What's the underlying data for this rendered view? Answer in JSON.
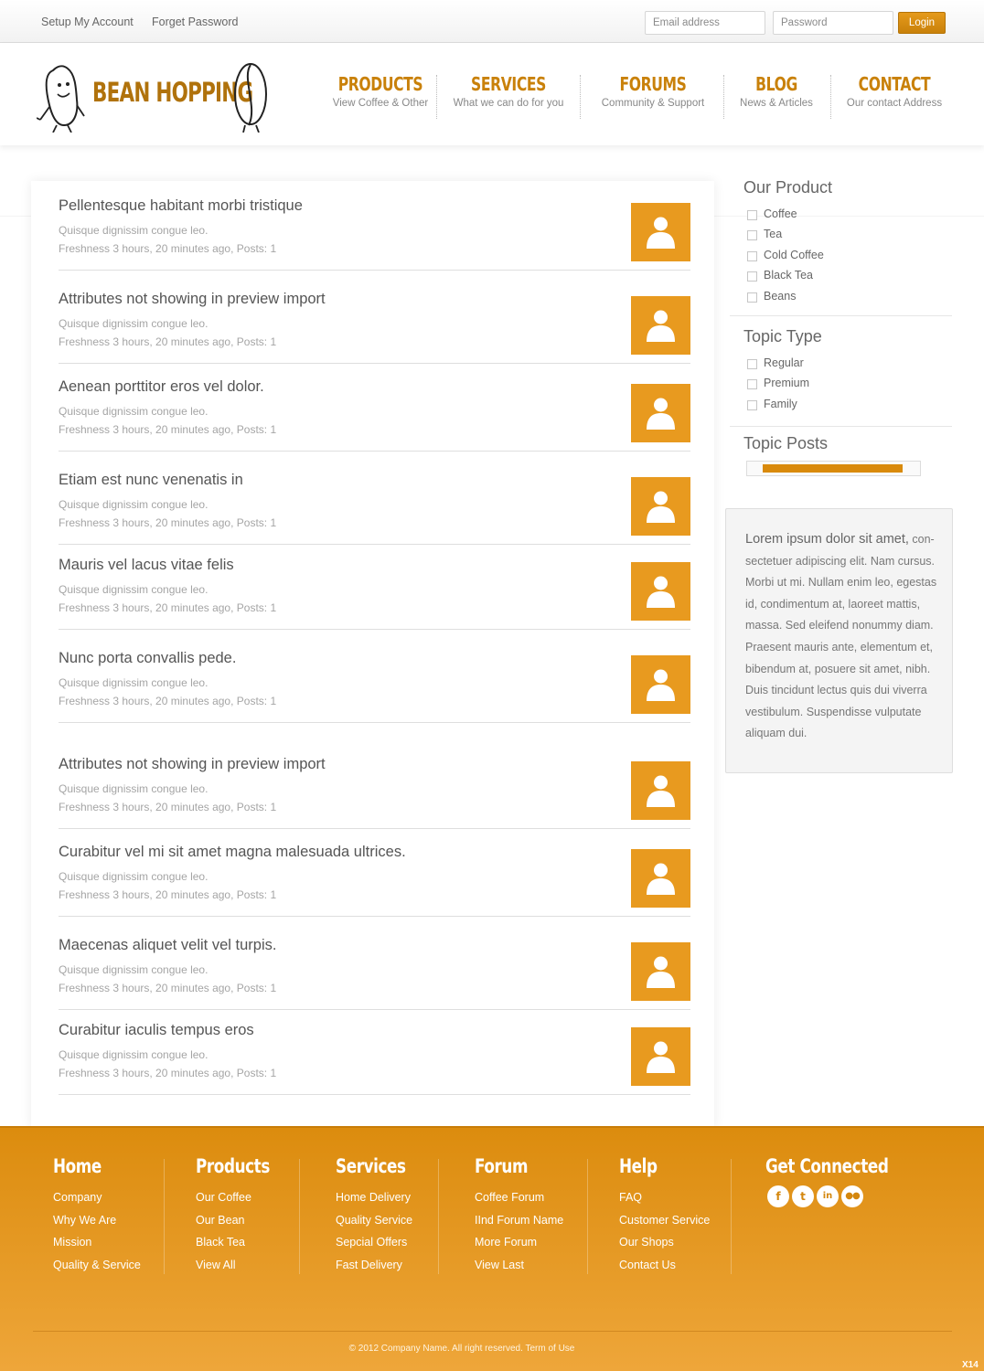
{
  "topbar": {
    "links": [
      "Setup My Account",
      "Forget Password"
    ],
    "email_placeholder": "Email address",
    "password_placeholder": "Password",
    "login_label": "Login"
  },
  "logo": {
    "text": "BEAN HOPPING"
  },
  "nav": [
    {
      "title": "PRODUCTS",
      "sub": "View Coffee & Other"
    },
    {
      "title": "SERVICES",
      "sub": "What we can do for you"
    },
    {
      "title": "FORUMS",
      "sub": "Community & Support"
    },
    {
      "title": "BLOG",
      "sub": "News & Articles"
    },
    {
      "title": "CONTACT",
      "sub": "Our contact Address"
    }
  ],
  "topics": [
    {
      "title": "Pellentesque habitant morbi tristique",
      "sub": "Quisque dignissim congue leo.",
      "meta": "Freshness 3 hours, 20 minutes ago, Posts: 1"
    },
    {
      "title": "Attributes not showing in preview import",
      "sub": "Quisque dignissim congue leo.",
      "meta": "Freshness 3 hours, 20 minutes ago, Posts: 1"
    },
    {
      "title": "Aenean porttitor eros vel dolor.",
      "sub": "Quisque dignissim congue leo.",
      "meta": "Freshness 3 hours, 20 minutes ago, Posts: 1"
    },
    {
      "title": "Etiam est nunc venenatis in",
      "sub": "Quisque dignissim congue leo.",
      "meta": "Freshness 3 hours, 20 minutes ago, Posts: 1"
    },
    {
      "title": "Mauris vel lacus vitae felis",
      "sub": "Quisque dignissim congue leo.",
      "meta": "Freshness 3 hours, 20 minutes ago, Posts: 1"
    },
    {
      "title": "Nunc porta convallis pede.",
      "sub": "Quisque dignissim congue leo.",
      "meta": "Freshness 3 hours, 20 minutes ago, Posts: 1"
    },
    {
      "title": "Attributes not showing in preview import",
      "sub": "Quisque dignissim congue leo.",
      "meta": "Freshness 3 hours, 20 minutes ago, Posts: 1"
    },
    {
      "title": "Curabitur vel mi sit amet magna malesuada ultrices.",
      "sub": "Quisque dignissim congue leo.",
      "meta": "Freshness 3 hours, 20 minutes ago, Posts: 1"
    },
    {
      "title": "Maecenas aliquet velit vel turpis.",
      "sub": "Quisque dignissim congue leo.",
      "meta": "Freshness 3 hours, 20 minutes ago, Posts: 1"
    },
    {
      "title": "Curabitur iaculis tempus eros",
      "sub": "Quisque dignissim congue leo.",
      "meta": "Freshness 3 hours, 20 minutes ago, Posts: 1"
    }
  ],
  "sidebar": {
    "product": {
      "title": "Our Product",
      "items": [
        "Coffee",
        "Tea",
        "Cold Coffee",
        "Black Tea",
        "Beans"
      ]
    },
    "topic_type": {
      "title": "Topic Type",
      "items": [
        "Regular",
        "Premium",
        "Family"
      ]
    },
    "topic_posts": {
      "title": "Topic Posts",
      "range": [
        0.09,
        0.9
      ]
    },
    "text_lead": "Lorem ipsum dolor sit amet,",
    "text_body": " con-sectetuer adipiscing elit. Nam cursus. Morbi ut mi. Nullam enim leo, egestas id, condimentum at, laoreet mattis, massa. Sed eleifend nonummy diam. Praesent mauris ante, elementum et, bibendum at, posuere sit amet, nibh. Duis tincidunt lectus quis dui viverra vestibulum. Suspendisse vulputate aliquam dui."
  },
  "footer": {
    "columns": [
      {
        "title": "Home",
        "items": [
          "Company",
          "Why We Are",
          "Mission",
          "Quality & Service"
        ]
      },
      {
        "title": "Products",
        "items": [
          "Our Coffee",
          "Our Bean",
          "Black Tea",
          "View All"
        ]
      },
      {
        "title": "Services",
        "items": [
          "Home Delivery",
          "Quality Service",
          "Sepcial Offers",
          "Fast Delivery"
        ]
      },
      {
        "title": "Forum",
        "items": [
          "Coffee Forum",
          "IInd Forum Name",
          "More Forum",
          "View Last"
        ]
      },
      {
        "title": "Help",
        "items": [
          "FAQ",
          "Customer Service",
          "Our Shops",
          "Contact Us"
        ]
      }
    ],
    "connected_title": "Get Connected",
    "social": [
      "facebook-icon",
      "twitter-icon",
      "linkedin-icon",
      "flickr-icon"
    ],
    "copyright": "© 2012 Company Name.  All right reserved.  Term of Use",
    "badge": "X14"
  },
  "colors": {
    "accent": "#c9810a",
    "avatar": "#e89a1f",
    "footer": "#e39716"
  }
}
